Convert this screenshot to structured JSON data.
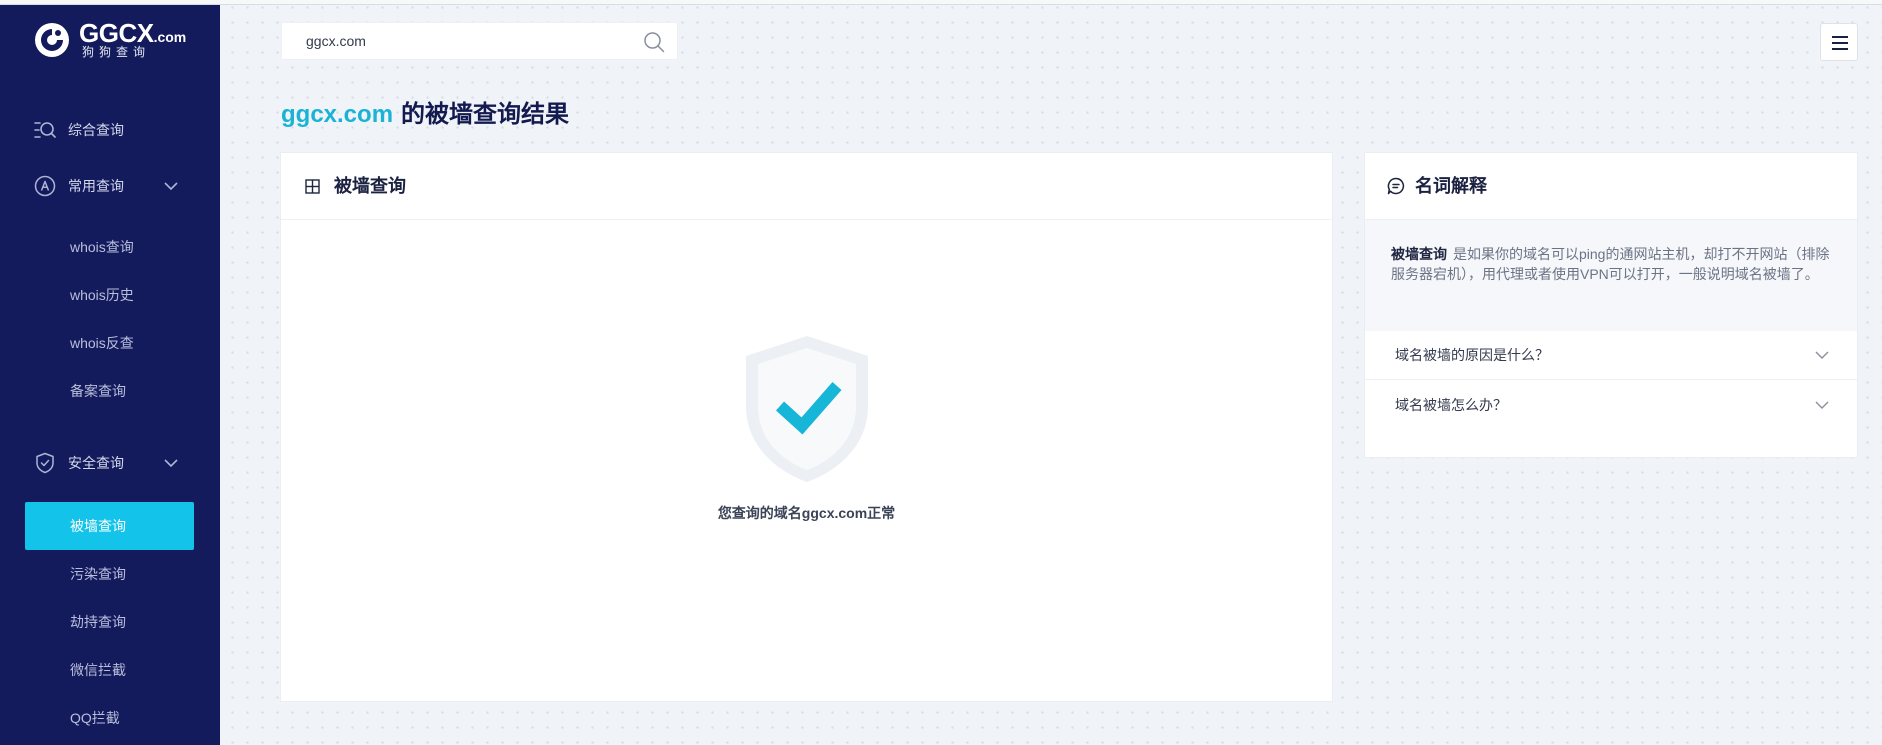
{
  "brand": {
    "name": "GGCX",
    "tld": ".com",
    "subtitle": "狗狗查询"
  },
  "sidebar": {
    "groups": [
      {
        "label": "综合查询",
        "icon": "search-list-icon"
      },
      {
        "label": "常用查询",
        "icon": "a-circle-icon",
        "expanded": true,
        "items": [
          {
            "label": "whois查询"
          },
          {
            "label": "whois历史"
          },
          {
            "label": "whois反查"
          },
          {
            "label": "备案查询"
          }
        ]
      },
      {
        "label": "安全查询",
        "icon": "shield-check-icon",
        "expanded": true,
        "items": [
          {
            "label": "被墙查询",
            "active": true
          },
          {
            "label": "污染查询"
          },
          {
            "label": "劫持查询"
          },
          {
            "label": "微信拦截"
          },
          {
            "label": "QQ拦截"
          }
        ]
      }
    ]
  },
  "search": {
    "value": "ggcx.com",
    "icon": "search-icon"
  },
  "header": {
    "menu_icon": "hamburger-icon"
  },
  "title": {
    "domain": "ggcx.com",
    "text": "的被墙查询结果"
  },
  "result_card": {
    "title": "被墙查询",
    "icon": "grid-icon",
    "status_icon": "shield-check-icon",
    "message": "您查询的域名ggcx.com正常"
  },
  "glossary": {
    "title": "名词解释",
    "icon": "chat-icon",
    "term": "被墙查询",
    "definition": "是如果你的域名可以ping的通网站主机，却打不开网站（排除服务器宕机），用代理或者使用VPN可以打开，一般说明域名被墙了。",
    "faq": [
      {
        "question": "域名被墙的原因是什么？"
      },
      {
        "question": "域名被墙怎么办？"
      }
    ]
  },
  "colors": {
    "sidebar_bg": "#141b5c",
    "accent": "#13c3ea",
    "brand": "#1ab3d6",
    "title": "#131a4f",
    "page_bg": "#f0f3f7"
  }
}
